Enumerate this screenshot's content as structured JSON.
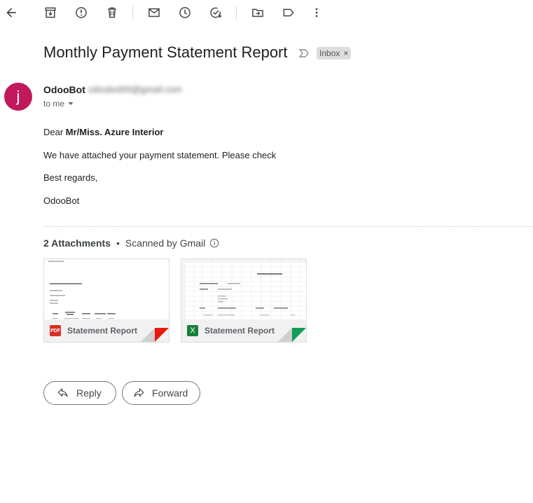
{
  "toolbar": {
    "items": [
      "back-icon",
      "archive-icon",
      "report-spam-icon",
      "delete-icon",
      "mark-unread-icon",
      "snooze-icon",
      "add-task-icon",
      "move-to-icon",
      "labels-icon",
      "more-icon"
    ]
  },
  "email": {
    "subject": "Monthly Payment Statement Report",
    "label_chip": "Inbox",
    "chip_close": "×",
    "avatar_letter": "j",
    "avatar_color": "#c2185b",
    "sender_name": "OdooBot",
    "sender_email": "odoobot00@gmail.com",
    "recipient": "to me",
    "greeting_prefix": "Dear ",
    "greeting_name": "Mr/Miss. Azure Interior",
    "line1": "We have attached your payment statement. Please check",
    "line2": "Best regards,",
    "line3": "OdooBot"
  },
  "attachments": {
    "count_label": "2 Attachments",
    "separator": "•",
    "scanned_label": "Scanned by Gmail",
    "items": [
      {
        "name": "Statement Report",
        "type": "pdf",
        "badge": "PDF",
        "badge_color": "#d93025",
        "corner_color": "#e8180c"
      },
      {
        "name": "Statement Report",
        "type": "xlsx",
        "badge": "X",
        "badge_color": "#188038",
        "corner_color": "#0f9d58"
      }
    ]
  },
  "actions": {
    "reply_label": "Reply",
    "forward_label": "Forward"
  }
}
